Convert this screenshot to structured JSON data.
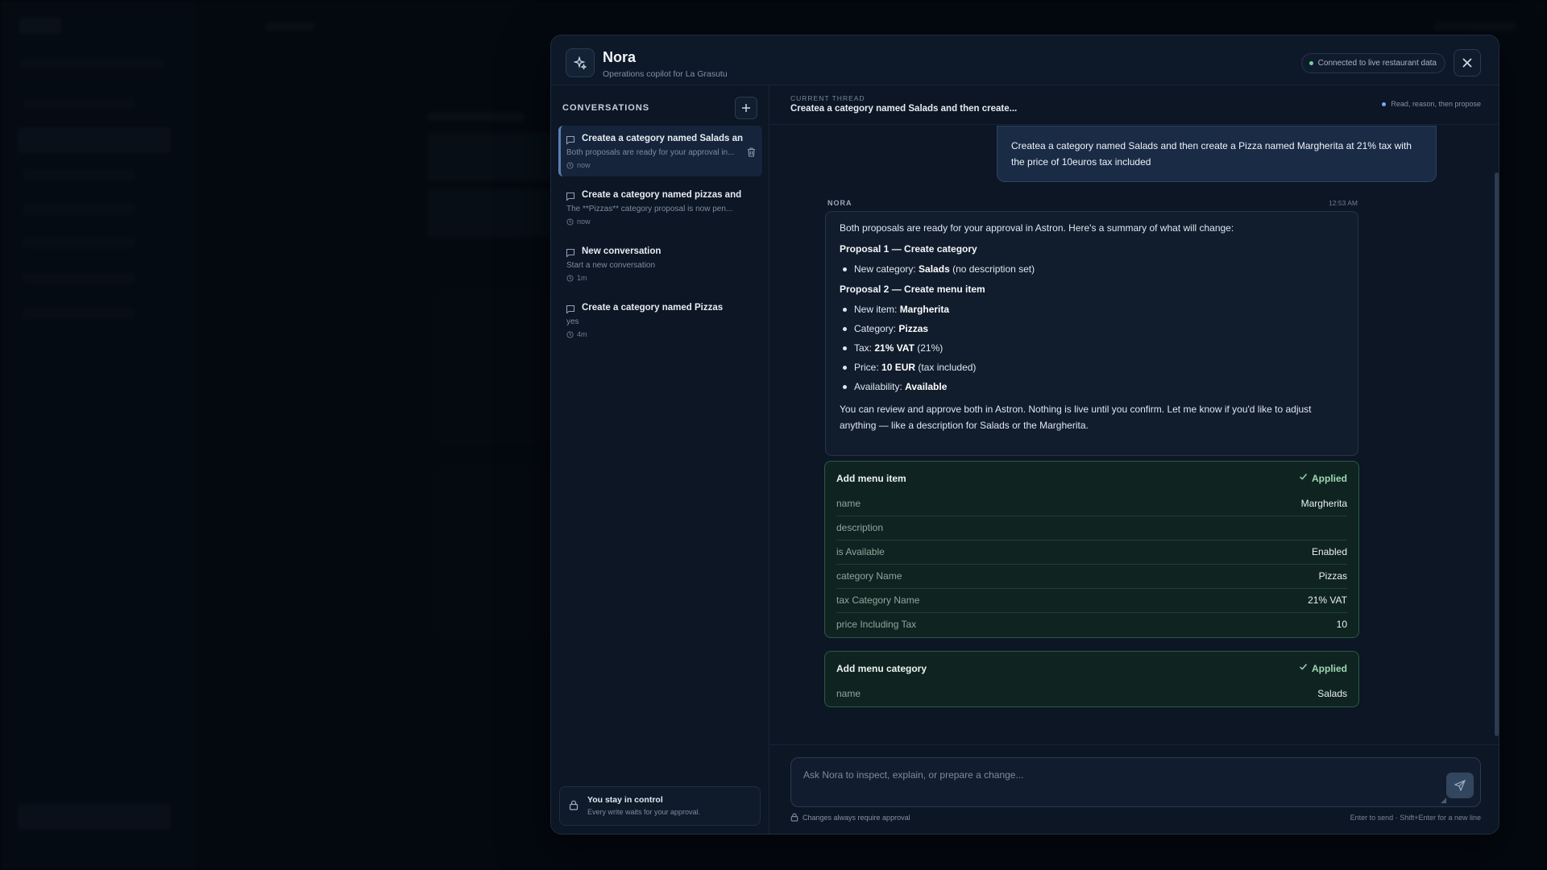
{
  "header": {
    "title": "Nora",
    "subtitle": "Operations copilot for La Grasutu",
    "connection_status": "Connected to live restaurant data",
    "icons": {
      "brand": "sparkles-icon",
      "close": "close-icon"
    }
  },
  "sidebar": {
    "title": "CONVERSATIONS",
    "items": [
      {
        "title": "Createa a category named Salads an",
        "preview": "Both proposals are ready for your approval in...",
        "time": "now",
        "active": true
      },
      {
        "title": "Create a category named pizzas and",
        "preview": "The **Pizzas** category proposal is now pen...",
        "time": "now",
        "active": false
      },
      {
        "title": "New conversation",
        "preview": "Start a new conversation",
        "time": "1m",
        "active": false
      },
      {
        "title": "Create a category named Pizzas",
        "preview": "yes",
        "time": "4m",
        "active": false
      }
    ],
    "control": {
      "title": "You stay in control",
      "subtitle": "Every write waits for your approval."
    }
  },
  "thread": {
    "label": "CURRENT THREAD",
    "title": "Createa a category named Salads and then create...",
    "mode": "Read, reason, then propose"
  },
  "messages": {
    "user": "Createa a category named Salads and then create a Pizza named Margherita at 21% tax with the price of 10euros tax included",
    "assistant_name": "NORA",
    "assistant_time": "12:53 AM",
    "assistant": {
      "intro": "Both proposals are ready for your approval in Astron. Here's a summary of what will change:",
      "p1_heading": "Proposal 1 — Create category",
      "p1_item_label": "New category: ",
      "p1_item_value": "Salads",
      "p1_item_note": " (no description set)",
      "p2_heading": "Proposal 2 — Create menu item",
      "p2_items": [
        {
          "label": "New item: ",
          "value": "Margherita",
          "note": ""
        },
        {
          "label": "Category: ",
          "value": "Pizzas",
          "note": ""
        },
        {
          "label": "Tax: ",
          "value": "21% VAT",
          "note": " (21%)"
        },
        {
          "label": "Price: ",
          "value": "10 EUR",
          "note": " (tax included)"
        },
        {
          "label": "Availability: ",
          "value": "Available",
          "note": ""
        }
      ],
      "closing": "You can review and approve both in Astron. Nothing is live until you confirm. Let me know if you'd like to adjust anything — like a description for Salads or the Margherita."
    }
  },
  "cards": [
    {
      "title": "Add menu item",
      "status": "Applied",
      "rows": [
        {
          "key": "name",
          "value": "Margherita"
        },
        {
          "key": "description",
          "value": ""
        },
        {
          "key": "is Available",
          "value": "Enabled"
        },
        {
          "key": "category Name",
          "value": "Pizzas"
        },
        {
          "key": "tax Category Name",
          "value": "21% VAT"
        },
        {
          "key": "price Including Tax",
          "value": "10"
        }
      ]
    },
    {
      "title": "Add menu category",
      "status": "Applied",
      "rows": [
        {
          "key": "name",
          "value": "Salads"
        }
      ]
    }
  ],
  "composer": {
    "placeholder": "Ask Nora to inspect, explain, or prepare a change...",
    "footer_left": "Changes always require approval",
    "footer_right": "Enter to send · Shift+Enter for a new line"
  },
  "colors": {
    "accent": "#5b7fb5",
    "applied": "#9fd7b4",
    "connected_dot": "#6fd39a",
    "user_bubble": "#1a2b45"
  }
}
